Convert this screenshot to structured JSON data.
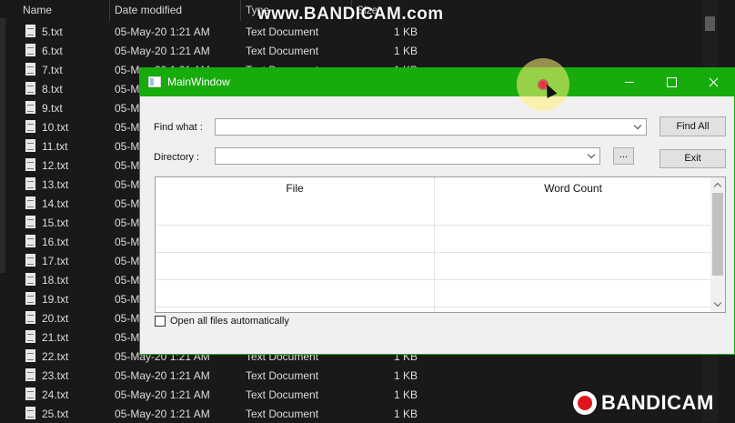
{
  "watermark": {
    "top_text": "www.BANDICAM.com",
    "bottom_text": "BANDICAM"
  },
  "explorer": {
    "columns": {
      "name": "Name",
      "date_modified": "Date modified",
      "type": "Type",
      "size": "Size"
    },
    "rows": [
      {
        "name": "5.txt",
        "date": "05-May-20 1:21 AM",
        "type": "Text Document",
        "size": "1 KB"
      },
      {
        "name": "6.txt",
        "date": "05-May-20 1:21 AM",
        "type": "Text Document",
        "size": "1 KB"
      },
      {
        "name": "7.txt",
        "date": "05-May-20 1:21 AM",
        "type": "Text Document",
        "size": "1 KB"
      },
      {
        "name": "8.txt",
        "date": "05-M",
        "type": "",
        "size": ""
      },
      {
        "name": "9.txt",
        "date": "05-M",
        "type": "",
        "size": ""
      },
      {
        "name": "10.txt",
        "date": "05-M",
        "type": "",
        "size": ""
      },
      {
        "name": "11.txt",
        "date": "05-M",
        "type": "",
        "size": ""
      },
      {
        "name": "12.txt",
        "date": "05-M",
        "type": "",
        "size": ""
      },
      {
        "name": "13.txt",
        "date": "05-M",
        "type": "",
        "size": ""
      },
      {
        "name": "14.txt",
        "date": "05-M",
        "type": "",
        "size": ""
      },
      {
        "name": "15.txt",
        "date": "05-M",
        "type": "",
        "size": ""
      },
      {
        "name": "16.txt",
        "date": "05-M",
        "type": "",
        "size": ""
      },
      {
        "name": "17.txt",
        "date": "05-M",
        "type": "",
        "size": ""
      },
      {
        "name": "18.txt",
        "date": "05-M",
        "type": "",
        "size": ""
      },
      {
        "name": "19.txt",
        "date": "05-M",
        "type": "",
        "size": ""
      },
      {
        "name": "20.txt",
        "date": "05-M",
        "type": "",
        "size": ""
      },
      {
        "name": "21.txt",
        "date": "05-M",
        "type": "",
        "size": ""
      },
      {
        "name": "22.txt",
        "date": "05-May-20 1:21 AM",
        "type": "Text Document",
        "size": "1 KB"
      },
      {
        "name": "23.txt",
        "date": "05-May-20 1:21 AM",
        "type": "Text Document",
        "size": "1 KB"
      },
      {
        "name": "24.txt",
        "date": "05-May-20 1:21 AM",
        "type": "Text Document",
        "size": "1 KB"
      },
      {
        "name": "25.txt",
        "date": "05-May-20 1:21 AM",
        "type": "Text Document",
        "size": "1 KB"
      }
    ]
  },
  "window": {
    "title": "MainWindow",
    "find_label": "Find what :",
    "find_value": "",
    "directory_label": "Directory :",
    "directory_value": "",
    "browse_label": "...",
    "find_all_label": "Find All",
    "exit_label": "Exit",
    "table": {
      "columns": [
        "File",
        "Word Count"
      ]
    },
    "auto_open_label": "Open all files automatically",
    "auto_open_checked": false
  },
  "colors": {
    "titlebar": "#18ab0c",
    "explorer_bg": "#191919",
    "window_bg": "#f0f0f0"
  }
}
